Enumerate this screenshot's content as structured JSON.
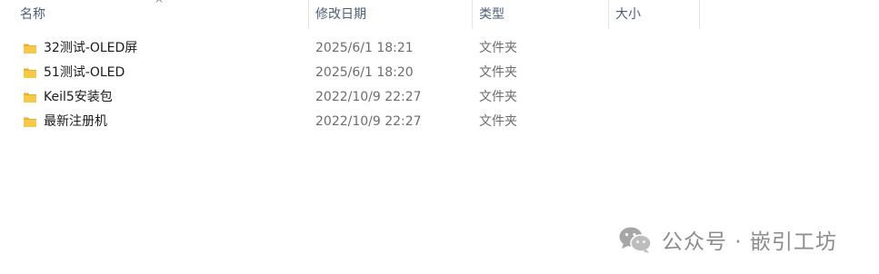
{
  "columns": {
    "name": "名称",
    "date_modified": "修改日期",
    "type": "类型",
    "size": "大小"
  },
  "sort_indicator": "^",
  "files": [
    {
      "name": "32测试-OLED屏",
      "date_modified": "2025/6/1 18:21",
      "type": "文件夹",
      "icon": "folder-icon"
    },
    {
      "name": "51测试-OLED",
      "date_modified": "2025/6/1 18:20",
      "type": "文件夹",
      "icon": "folder-icon"
    },
    {
      "name": "Keil5安装包",
      "date_modified": "2022/10/9 22:27",
      "type": "文件夹",
      "icon": "folder-icon"
    },
    {
      "name": "最新注册机",
      "date_modified": "2022/10/9 22:27",
      "type": "文件夹",
      "icon": "folder-icon"
    }
  ],
  "watermark": {
    "text": "公众号 · 嵌引工坊",
    "icon": "wechat-logo-icon"
  },
  "colors": {
    "folder_yellow": "#f5c44a",
    "header_text": "#4c607a",
    "secondary_text": "#6d6d6d"
  }
}
